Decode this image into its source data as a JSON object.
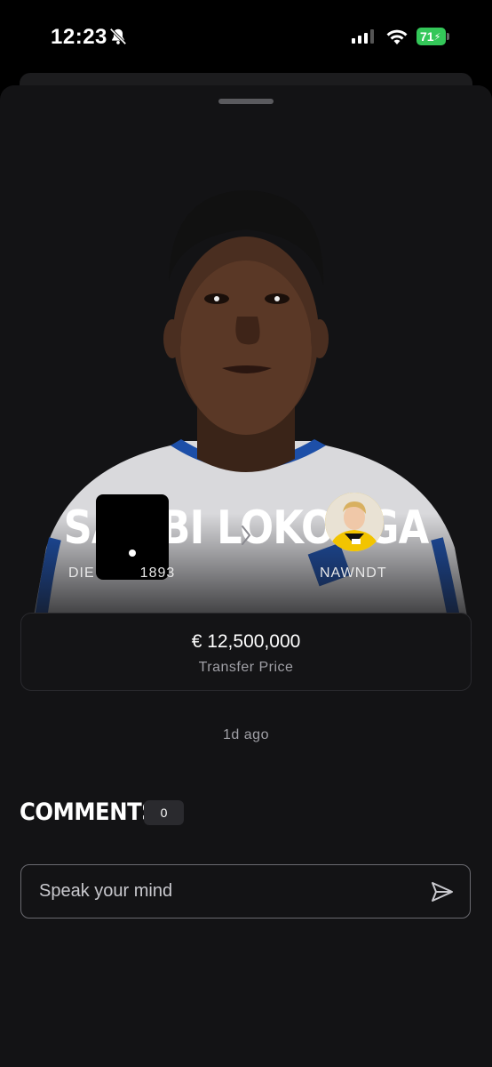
{
  "status_bar": {
    "time": "12:23",
    "battery_level": "71",
    "icons": [
      "bell-slash-icon",
      "signal-icon",
      "wifi-icon",
      "battery-icon"
    ]
  },
  "player": {
    "name": "SAMBI LOKONGA"
  },
  "transfer": {
    "from_name": "DIE   1893",
    "to_name": "NAWNDT",
    "arrow_icon": "chevron-right-icon"
  },
  "price": {
    "value": "€ 12,500,000",
    "label": "Transfer Price"
  },
  "time_ago": "1d ago",
  "comments": {
    "title": "COMMENTS",
    "count": "0",
    "input_placeholder": "Speak your mind",
    "send_icon": "send-icon"
  },
  "colors": {
    "background": "#131315",
    "battery": "#34c759",
    "kit_blue": "#1d4fa8"
  }
}
